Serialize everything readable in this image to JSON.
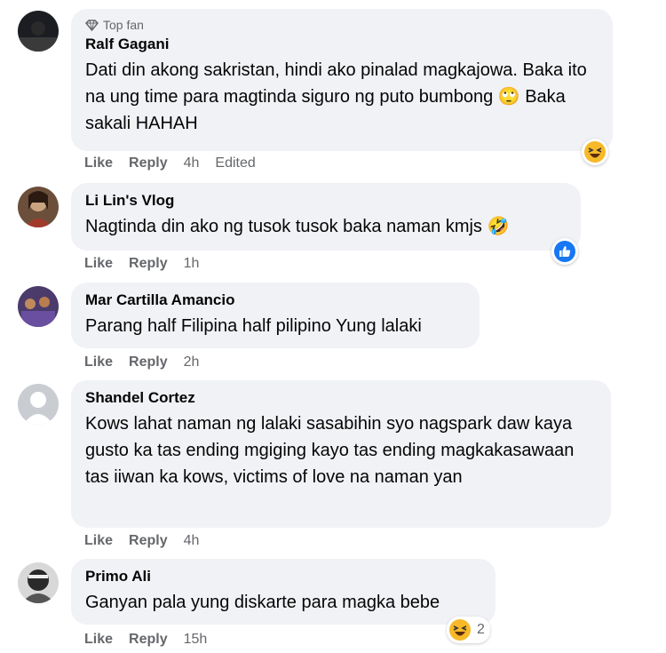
{
  "comments": [
    {
      "badge": "Top fan",
      "name": "Ralf Gagani",
      "text": "Dati din akong sakristan, hindi ako pinalad magkajowa. Baka ito na ung time para magtinda siguro ng puto bumbong 🙄 Baka sakali HAHAH",
      "like": "Like",
      "reply": "Reply",
      "time": "4h",
      "edited": "Edited",
      "reaction_icon": "haha-icon"
    },
    {
      "name": "Li Lin's Vlog",
      "text": "Nagtinda din ako ng tusok tusok baka naman kmjs 🤣",
      "like": "Like",
      "reply": "Reply",
      "time": "1h",
      "reaction_icon": "like-icon"
    },
    {
      "name": "Mar Cartilla Amancio",
      "text": "Parang half Filipina half pilipino Yung lalaki",
      "like": "Like",
      "reply": "Reply",
      "time": "2h"
    },
    {
      "name": "Shandel Cortez",
      "text": "Kows lahat naman ng lalaki sasabihin syo nagspark daw kaya gusto ka tas ending mgiging kayo tas ending magkakasawaan tas iiwan ka kows, victims of love na naman yan",
      "like": "Like",
      "reply": "Reply",
      "time": "4h"
    },
    {
      "name": "Primo Ali",
      "text": "Ganyan pala yung diskarte para magka bebe",
      "like": "Like",
      "reply": "Reply",
      "time": "15h",
      "reaction_icon": "haha-icon",
      "reaction_count": "2"
    }
  ],
  "colors": {
    "bubble": "#f0f2f5",
    "meta_text": "#65676b",
    "like_blue": "#1877f2",
    "haha_yellow": "#f7b928"
  }
}
